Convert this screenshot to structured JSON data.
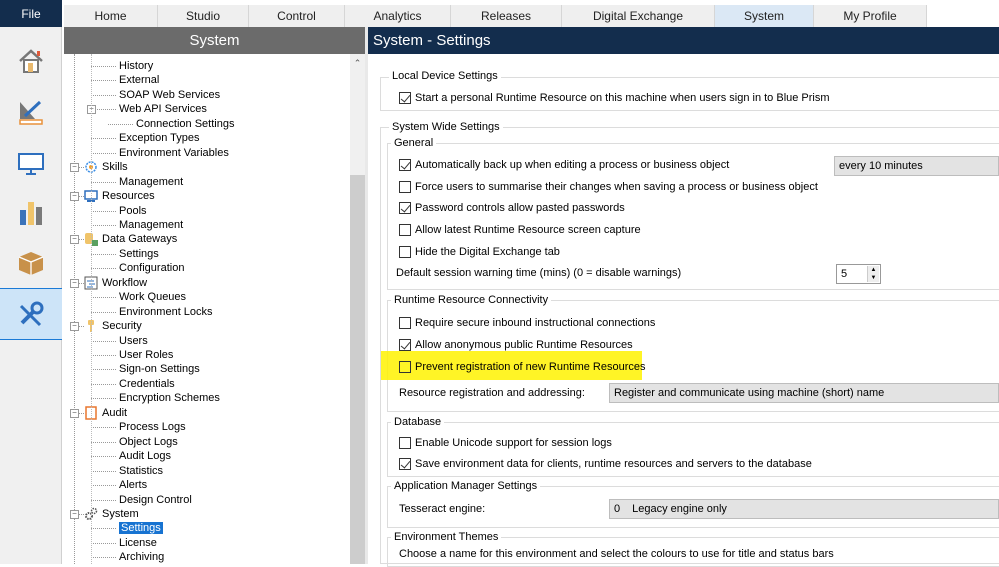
{
  "menu": {
    "file": "File"
  },
  "tabs": [
    "Home",
    "Studio",
    "Control",
    "Analytics",
    "Releases",
    "Digital Exchange",
    "System",
    "My Profile"
  ],
  "selected_tab": "System",
  "rail": [
    "home-icon",
    "studio-icon",
    "control-icon",
    "analytics-icon",
    "releases-icon",
    "system-icon"
  ],
  "left_panel": {
    "title": "System",
    "tree": [
      {
        "label": "History",
        "level": 1
      },
      {
        "label": "External",
        "level": 1
      },
      {
        "label": "SOAP Web Services",
        "level": 1
      },
      {
        "label": "Web API Services",
        "level": 1,
        "expander": true
      },
      {
        "label": "Connection Settings",
        "level": 2
      },
      {
        "label": "Exception Types",
        "level": 1
      },
      {
        "label": "Environment Variables",
        "level": 1
      },
      {
        "label": "Skills",
        "level": 0,
        "icon": "skills-icon"
      },
      {
        "label": "Management",
        "level": 1
      },
      {
        "label": "Resources",
        "level": 0,
        "icon": "resources-icon"
      },
      {
        "label": "Pools",
        "level": 1
      },
      {
        "label": "Management",
        "level": 1
      },
      {
        "label": "Data Gateways",
        "level": 0,
        "icon": "data-gateways-icon"
      },
      {
        "label": "Settings",
        "level": 1
      },
      {
        "label": "Configuration",
        "level": 1
      },
      {
        "label": "Workflow",
        "level": 0,
        "icon": "workflow-icon"
      },
      {
        "label": "Work Queues",
        "level": 1
      },
      {
        "label": "Environment Locks",
        "level": 1
      },
      {
        "label": "Security",
        "level": 0,
        "icon": "key-icon"
      },
      {
        "label": "Users",
        "level": 1
      },
      {
        "label": "User Roles",
        "level": 1
      },
      {
        "label": "Sign-on Settings",
        "level": 1
      },
      {
        "label": "Credentials",
        "level": 1
      },
      {
        "label": "Encryption Schemes",
        "level": 1
      },
      {
        "label": "Audit",
        "level": 0,
        "icon": "audit-icon"
      },
      {
        "label": "Process Logs",
        "level": 1
      },
      {
        "label": "Object Logs",
        "level": 1
      },
      {
        "label": "Audit Logs",
        "level": 1
      },
      {
        "label": "Statistics",
        "level": 1
      },
      {
        "label": "Alerts",
        "level": 1
      },
      {
        "label": "Design Control",
        "level": 1
      },
      {
        "label": "System",
        "level": 0,
        "icon": "gears-icon"
      },
      {
        "label": "Settings",
        "level": 1,
        "selected": true
      },
      {
        "label": "License",
        "level": 1
      },
      {
        "label": "Archiving",
        "level": 1
      }
    ]
  },
  "main": {
    "title": "System - Settings",
    "local_device": {
      "title": "Local Device Settings",
      "start_personal": {
        "label": "Start a personal Runtime Resource on this machine when users sign in to Blue Prism",
        "checked": true
      }
    },
    "system_wide": {
      "title": "System Wide Settings",
      "general": {
        "title": "General",
        "auto_backup": {
          "label": "Automatically back up when editing a process or business object",
          "checked": true,
          "interval": "every 10 minutes"
        },
        "force_summarise": {
          "label": "Force users to summarise their changes when saving a process or business object",
          "checked": false
        },
        "password_paste": {
          "label": "Password controls allow pasted passwords",
          "checked": true
        },
        "screen_capture": {
          "label": "Allow latest Runtime Resource screen capture",
          "checked": false
        },
        "hide_dx": {
          "label": "Hide the Digital Exchange tab",
          "checked": false
        },
        "session_warning_label": "Default session warning time (mins) (0 = disable warnings)",
        "session_warning_value": "5"
      },
      "connectivity": {
        "title": "Runtime Resource Connectivity",
        "require_secure": {
          "label": "Require secure inbound instructional connections",
          "checked": false
        },
        "allow_anon": {
          "label": "Allow anonymous public Runtime Resources",
          "checked": true
        },
        "prevent_registration": {
          "label": "Prevent registration of new Runtime Resources",
          "checked": false
        },
        "addressing_label": "Resource registration and addressing:",
        "addressing_value": "Register and communicate using machine (short) name"
      },
      "database": {
        "title": "Database",
        "unicode": {
          "label": "Enable Unicode support for session logs",
          "checked": false
        },
        "save_env": {
          "label": "Save environment data for clients, runtime resources and servers to the database",
          "checked": true
        }
      },
      "app_manager": {
        "title": "Application Manager Settings",
        "tesseract_label": "Tesseract engine:",
        "tesseract_num": "0",
        "tesseract_value": "Legacy engine only"
      },
      "themes": {
        "title": "Environment Themes",
        "description": "Choose a name for this environment and select the colours to use for title and status bars"
      }
    }
  },
  "colors": {
    "navy": "#132d4d",
    "highlight": "#fff200",
    "selection": "#1773d1"
  }
}
